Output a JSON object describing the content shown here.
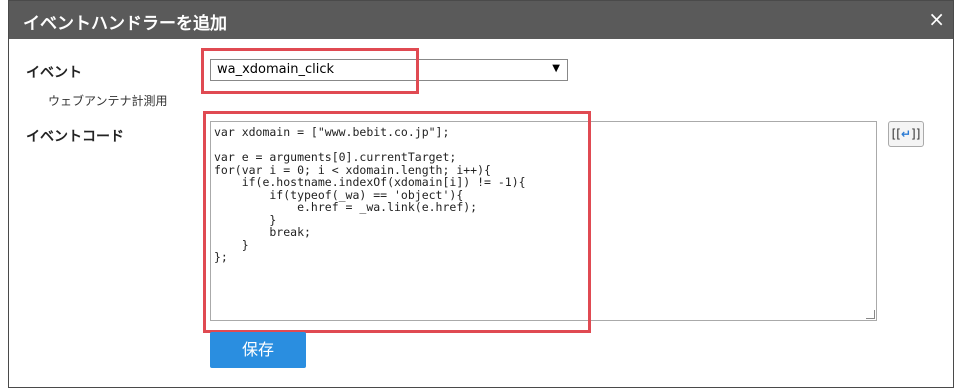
{
  "dialog": {
    "title": "イベントハンドラーを追加",
    "close_icon": "×"
  },
  "event": {
    "label": "イベント",
    "sublabel": "ウェブアンテナ計測用",
    "selected": "wa_xdomain_click",
    "arrow": "▼"
  },
  "code": {
    "label": "イベントコード",
    "value": "var xdomain = [\"www.bebit.co.jp\"];\n\nvar e = arguments[0].currentTarget;\nfor(var i = 0; i < xdomain.length; i++){\n    if(e.hostname.indexOf(xdomain[i]) != -1){\n        if(typeof(_wa) == 'object'){\n            e.href = _wa.link(e.href);\n        }\n        break;\n    }\n};"
  },
  "format_button": {
    "icon": "format-return-icon"
  },
  "save_label": "保存",
  "colors": {
    "titlebar": "#5a5a5a",
    "highlight": "#e04a52",
    "save": "#2a8ee0"
  }
}
